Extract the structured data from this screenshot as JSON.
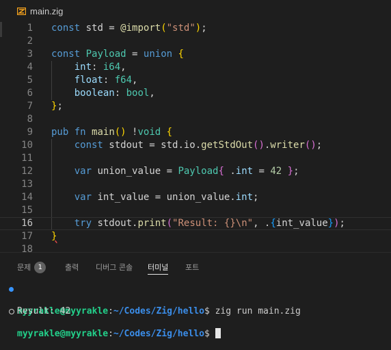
{
  "tab": {
    "filename": "main.zig"
  },
  "editor": {
    "current_line": 16,
    "lines": [
      {
        "n": "1",
        "tokens": [
          [
            "kw",
            "const"
          ],
          [
            "",
            " std = "
          ],
          [
            "fn",
            "@import"
          ],
          [
            "br1",
            "("
          ],
          [
            "str",
            "\"std\""
          ],
          [
            "br1",
            ")"
          ],
          [
            "",
            ";"
          ]
        ]
      },
      {
        "n": "2",
        "tokens": []
      },
      {
        "n": "3",
        "tokens": [
          [
            "kw",
            "const"
          ],
          [
            "",
            " "
          ],
          [
            "ty",
            "Payload"
          ],
          [
            "",
            " = "
          ],
          [
            "kw",
            "union"
          ],
          [
            "",
            " "
          ],
          [
            "br1",
            "{"
          ]
        ]
      },
      {
        "n": "4",
        "tokens": [
          [
            "",
            "    "
          ],
          [
            "var",
            "int"
          ],
          [
            "",
            ": "
          ],
          [
            "ty",
            "i64"
          ],
          [
            "",
            ","
          ]
        ]
      },
      {
        "n": "5",
        "tokens": [
          [
            "",
            "    "
          ],
          [
            "var",
            "float"
          ],
          [
            "",
            ": "
          ],
          [
            "ty",
            "f64"
          ],
          [
            "",
            ","
          ]
        ]
      },
      {
        "n": "6",
        "tokens": [
          [
            "",
            "    "
          ],
          [
            "var",
            "boolean"
          ],
          [
            "",
            ": "
          ],
          [
            "ty",
            "bool"
          ],
          [
            "",
            ","
          ]
        ]
      },
      {
        "n": "7",
        "tokens": [
          [
            "br1",
            "}"
          ],
          [
            "",
            ";"
          ]
        ]
      },
      {
        "n": "8",
        "tokens": []
      },
      {
        "n": "9",
        "tokens": [
          [
            "kw",
            "pub"
          ],
          [
            "",
            " "
          ],
          [
            "kw",
            "fn"
          ],
          [
            "",
            " "
          ],
          [
            "fn",
            "main"
          ],
          [
            "br1",
            "()"
          ],
          [
            "",
            " !"
          ],
          [
            "ty",
            "void"
          ],
          [
            "",
            " "
          ],
          [
            "br1",
            "{"
          ]
        ]
      },
      {
        "n": "10",
        "tokens": [
          [
            "",
            "    "
          ],
          [
            "kw",
            "const"
          ],
          [
            "",
            " stdout = std.io."
          ],
          [
            "fn",
            "getStdOut"
          ],
          [
            "br2",
            "()"
          ],
          [
            "",
            "."
          ],
          [
            "fn",
            "writer"
          ],
          [
            "br2",
            "()"
          ],
          [
            "",
            ";"
          ]
        ]
      },
      {
        "n": "11",
        "tokens": []
      },
      {
        "n": "12",
        "tokens": [
          [
            "",
            "    "
          ],
          [
            "kw",
            "var"
          ],
          [
            "",
            " union_value = "
          ],
          [
            "ty",
            "Payload"
          ],
          [
            "br2",
            "{"
          ],
          [
            "",
            " ."
          ],
          [
            "var",
            "int"
          ],
          [
            "",
            " = "
          ],
          [
            "num",
            "42"
          ],
          [
            "",
            " "
          ],
          [
            "br2",
            "}"
          ],
          [
            "",
            ";"
          ]
        ]
      },
      {
        "n": "13",
        "tokens": []
      },
      {
        "n": "14",
        "tokens": [
          [
            "",
            "    "
          ],
          [
            "kw",
            "var"
          ],
          [
            "",
            " int_value = union_value."
          ],
          [
            "var",
            "int"
          ],
          [
            "",
            ";"
          ]
        ]
      },
      {
        "n": "15",
        "tokens": []
      },
      {
        "n": "16",
        "tokens": [
          [
            "",
            "    "
          ],
          [
            "kw",
            "try"
          ],
          [
            "",
            " stdout."
          ],
          [
            "fn",
            "print"
          ],
          [
            "br2",
            "("
          ],
          [
            "str",
            "\"Result: {}\\n\""
          ],
          [
            "",
            ", ."
          ],
          [
            "br3",
            "{"
          ],
          [
            "",
            "int_value"
          ],
          [
            "br3",
            "}"
          ],
          [
            "br2",
            ")"
          ],
          [
            "",
            ";"
          ]
        ]
      },
      {
        "n": "17",
        "tokens": [
          [
            "br1 squiggle",
            "}"
          ]
        ]
      },
      {
        "n": "18",
        "tokens": []
      }
    ]
  },
  "panel": {
    "tabs": [
      {
        "label": "문제",
        "badge": "1",
        "active": false
      },
      {
        "label": "출력",
        "active": false
      },
      {
        "label": "디버그 콘솔",
        "active": false
      },
      {
        "label": "터미널",
        "active": true
      },
      {
        "label": "포트",
        "active": false
      }
    ]
  },
  "terminal": {
    "line1": {
      "user": "myyrakle@myyrakle",
      "sep": ":",
      "path": "~/Codes/Zig/hello",
      "cmd": "$ zig run main.zig"
    },
    "line2": "Result: 42",
    "line3": {
      "user": "myyrakle@myyrakle",
      "sep": ":",
      "path": "~/Codes/Zig/hello",
      "cmd": "$ "
    }
  },
  "colors": {
    "background": "#1e1e1e",
    "keyword": "#569cd6",
    "type": "#4ec9b0",
    "function": "#dcdcaa",
    "string": "#ce9178",
    "terminal_user": "#23d18b",
    "terminal_path": "#3b8eea",
    "zig_brand": "#f7a41d"
  },
  "icons": {
    "file": "zig-icon",
    "status_success": "filled-dot-icon",
    "status_idle": "hollow-dot-icon"
  }
}
